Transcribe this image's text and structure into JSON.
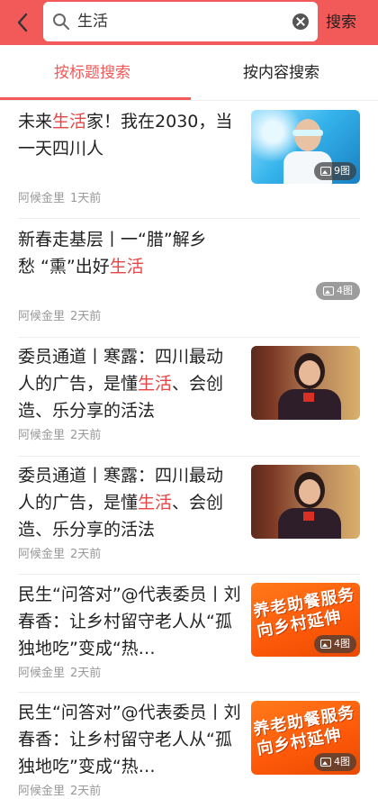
{
  "search": {
    "query": "生活",
    "submit_label": "搜索"
  },
  "tabs": {
    "by_title": "按标题搜索",
    "by_content": "按内容搜索"
  },
  "accent_color": "#f25a5a",
  "results": [
    {
      "title_before": "未来",
      "title_highlight": "生活",
      "title_after": "家！我在2030，当一天四川人",
      "author": "阿候金里",
      "time": "1天前",
      "image_count": "9图"
    },
    {
      "title_before": "新春走基层丨一“腊”解乡愁 “熏”出好",
      "title_highlight": "生活",
      "title_after": "",
      "author": "阿候金里",
      "time": "2天前",
      "image_count": "4图"
    },
    {
      "title_before": "委员通道丨寒露：四川最动人的广告，是懂",
      "title_highlight": "生活",
      "title_after": "、会创造、乐分享的活法",
      "author": "阿候金里",
      "time": "2天前"
    },
    {
      "title_before": "委员通道丨寒露：四川最动人的广告，是懂",
      "title_highlight": "生活",
      "title_after": "、会创造、乐分享的活法",
      "author": "阿候金里",
      "time": "2天前"
    },
    {
      "title_before": "民生“问答对”@代表委员丨刘春香：让乡村留守老人从“孤独地吃”变成“热…",
      "title_highlight": "",
      "title_after": "",
      "author": "阿候金里",
      "time": "2天前",
      "image_count": "4图",
      "image_text_line1": "养老助餐服务",
      "image_text_line2": "向乡村延伸"
    },
    {
      "title_before": "民生“问答对”@代表委员丨刘春香：让乡村留守老人从“孤独地吃”变成“热…",
      "title_highlight": "",
      "title_after": "",
      "author": "阿候金里",
      "time": "2天前",
      "image_count": "4图",
      "image_text_line1": "养老助餐服务",
      "image_text_line2": "向乡村延伸"
    }
  ]
}
